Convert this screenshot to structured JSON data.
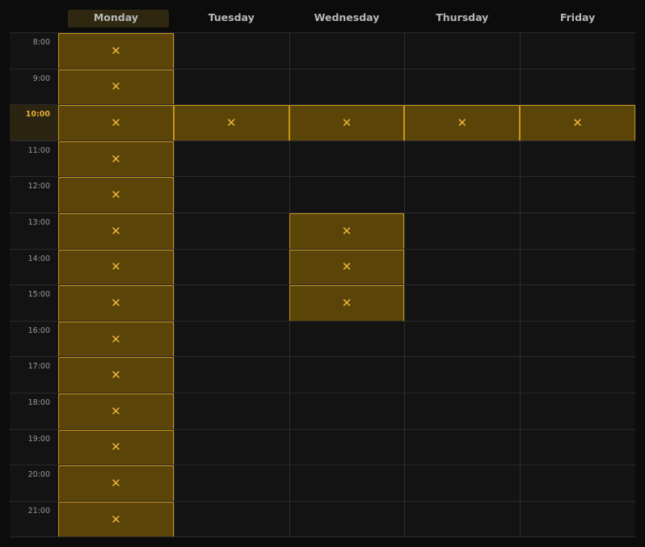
{
  "schedule": {
    "days": [
      "Monday",
      "Tuesday",
      "Wednesday",
      "Thursday",
      "Friday"
    ],
    "active_day": "Monday",
    "times": [
      "8:00",
      "9:00",
      "10:00",
      "11:00",
      "12:00",
      "13:00",
      "14:00",
      "15:00",
      "16:00",
      "17:00",
      "18:00",
      "19:00",
      "20:00",
      "21:00"
    ],
    "active_time": "10:00",
    "selected_mark": "✕",
    "selected_cells": {
      "Monday": [
        "8:00",
        "9:00",
        "10:00",
        "11:00",
        "12:00",
        "13:00",
        "14:00",
        "15:00",
        "16:00",
        "17:00",
        "18:00",
        "19:00",
        "20:00",
        "21:00"
      ],
      "Tuesday": [
        "10:00"
      ],
      "Wednesday": [
        "10:00",
        "13:00",
        "14:00",
        "15:00"
      ],
      "Thursday": [
        "10:00"
      ],
      "Friday": [
        "10:00"
      ]
    }
  },
  "colors": {
    "background": "#0c0c0c",
    "grid_background": "#131313",
    "selected_fill": "#5a4408",
    "selected_border": "#c9961d",
    "accent": "#f0b83b"
  }
}
